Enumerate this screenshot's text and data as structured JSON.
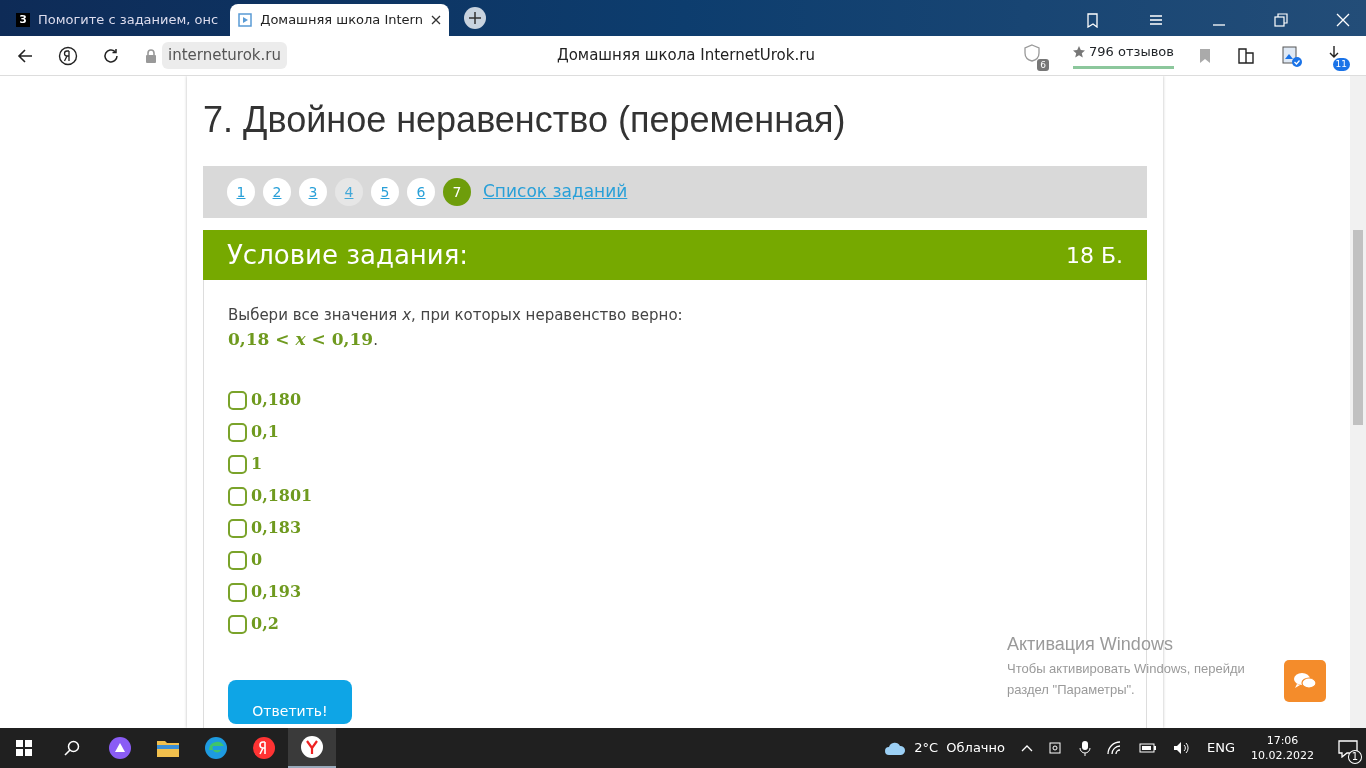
{
  "browser": {
    "tabs": [
      {
        "title": "Помогите с заданием, онс",
        "favicon": "З",
        "selected": false
      },
      {
        "title": "Домашняя школа Intern",
        "selected": true
      }
    ],
    "address": "interneturok.ru",
    "page_title": "Домашняя школа InternetUrok.ru",
    "protect_badge": "6",
    "reviews": "796 отзывов",
    "downloads_badge": "11"
  },
  "page": {
    "heading": "7. Двойное неравенство (переменная)",
    "pager": [
      {
        "label": "1",
        "selected": false,
        "muted": false
      },
      {
        "label": "2",
        "selected": false,
        "muted": false
      },
      {
        "label": "3",
        "selected": false,
        "muted": false
      },
      {
        "label": "4",
        "selected": false,
        "muted": true
      },
      {
        "label": "5",
        "selected": false,
        "muted": false
      },
      {
        "label": "6",
        "selected": false,
        "muted": false
      },
      {
        "label": "7",
        "selected": true,
        "muted": false
      }
    ],
    "task_list_link": "Список заданий",
    "task_title": "Условие задания:",
    "points": "18 Б.",
    "statement": "Выбери все значения *x*, при которых неравенство верно:",
    "formula": "0,18 < *x* < 0,19",
    "formula_end": ".",
    "options": [
      {
        "label": "0,180",
        "checked": false
      },
      {
        "label": "0,1",
        "checked": false
      },
      {
        "label": "1",
        "checked": false
      },
      {
        "label": "0,1801",
        "checked": false
      },
      {
        "label": "0,183",
        "checked": false
      },
      {
        "label": "0",
        "checked": false
      },
      {
        "label": "0,193",
        "checked": false
      },
      {
        "label": "0,2",
        "checked": false
      }
    ],
    "submit": "Ответить!"
  },
  "activation": {
    "title": "Активация Windows",
    "text": "Чтобы активировать Windows, перейди",
    "text2": "раздел \"Параметры\"."
  },
  "taskbar": {
    "weather": "2°C  Облачно",
    "language": "ENG",
    "time": "17:06",
    "date": "10.02.2022",
    "notifications": "1"
  }
}
